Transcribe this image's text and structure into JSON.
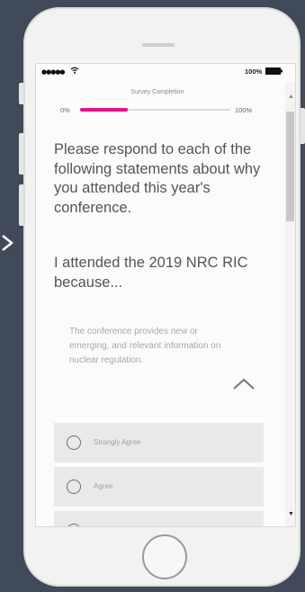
{
  "survey": {
    "progress_title": "Survey Completion",
    "progress_min": "0%",
    "progress_max": "100%",
    "progress_fraction": 0.32,
    "accent_color": "#e0158a"
  },
  "status_bar": {
    "signal": "●●●●●",
    "battery_percent": "100%"
  },
  "content": {
    "instructions": "Please respond to each of the following statements about why you attended this year's conference.",
    "question_lead": "I attended the 2019 NRC RIC because...",
    "statement": "The conference provides new or emerging, and relevant information on nuclear regulation."
  },
  "options": [
    {
      "label": "Strongly Agree"
    },
    {
      "label": "Agree"
    }
  ],
  "icons": {
    "back": "chevron-right-icon",
    "collapse": "chevron-up-icon",
    "wifi": "wifi-icon",
    "battery": "battery-icon"
  }
}
